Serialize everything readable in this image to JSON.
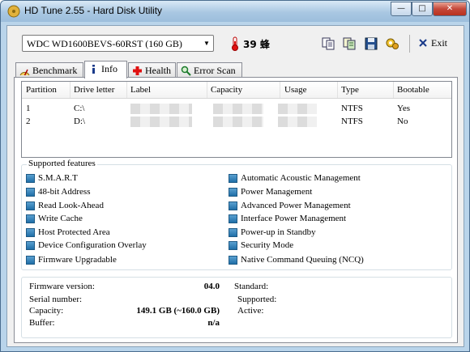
{
  "window": {
    "title": "HD Tune 2.55 - Hard Disk Utility",
    "minimize_glyph": "—",
    "maximize_glyph": "□",
    "close_glyph": "✕"
  },
  "toolbar": {
    "drive": "WDC WD1600BEVS-60RST (160 GB)",
    "temperature": "39 蜂",
    "exit_label": "Exit",
    "icons": [
      "copy-icon",
      "copy-all-icon",
      "save-icon",
      "options-icon"
    ]
  },
  "tabs": [
    {
      "label": "Benchmark",
      "icon": "benchmark-icon",
      "active": false
    },
    {
      "label": "Info",
      "icon": "info-icon",
      "active": true
    },
    {
      "label": "Health",
      "icon": "health-icon",
      "active": false
    },
    {
      "label": "Error Scan",
      "icon": "error-scan-icon",
      "active": false
    }
  ],
  "partitions": {
    "columns": [
      "Partition",
      "Drive letter",
      "Label",
      "Capacity",
      "Usage",
      "Type",
      "Bootable"
    ],
    "rows": [
      {
        "partition": "1",
        "drive_letter": "C:\\",
        "type": "NTFS",
        "bootable": "Yes"
      },
      {
        "partition": "2",
        "drive_letter": "D:\\",
        "type": "NTFS",
        "bootable": "No"
      }
    ]
  },
  "features": {
    "title": "Supported features",
    "left": [
      "S.M.A.R.T",
      "48-bit Address",
      "Read Look-Ahead",
      "Write Cache",
      "Host Protected Area",
      "Device Configuration Overlay",
      "Firmware Upgradable"
    ],
    "right": [
      "Automatic Acoustic Management",
      "Power Management",
      "Advanced Power Management",
      "Interface Power Management",
      "Power-up in Standby",
      "Security Mode",
      "Native Command Queuing (NCQ)"
    ]
  },
  "details": {
    "firmware_label": "Firmware version:",
    "firmware_value": "04.0",
    "serial_label": "Serial number:",
    "serial_value": "",
    "capacity_label": "Capacity:",
    "capacity_value": "149.1 GB (~160.0 GB)",
    "buffer_label": "Buffer:",
    "buffer_value": "n/a",
    "standard_label": "Standard:",
    "supported_label": "Supported:",
    "active_label": "Active:"
  },
  "colors": {
    "titlebar": "#b9d4ea",
    "feature_box": "#1f6fa8",
    "close_button": "#c5483a"
  }
}
